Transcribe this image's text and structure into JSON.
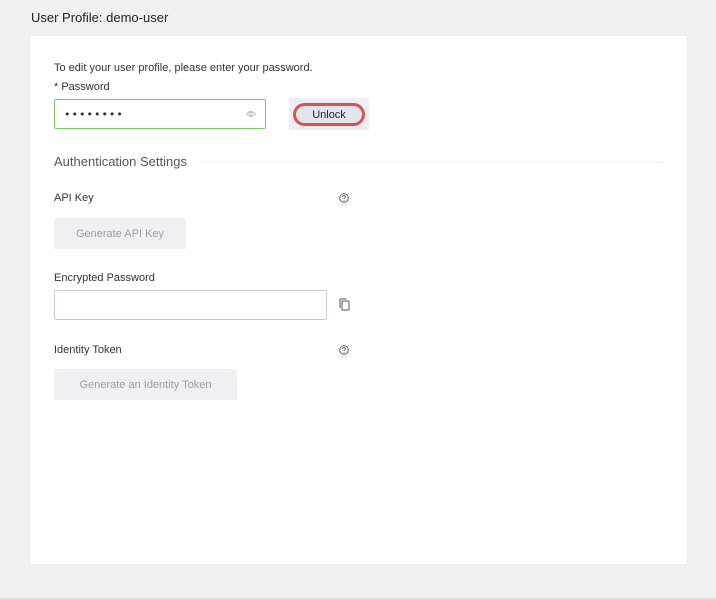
{
  "page": {
    "title": "User Profile: demo-user"
  },
  "unlock_form": {
    "prompt": "To edit your user profile, please enter your password.",
    "password_label": "* Password",
    "password_value": "••••••••",
    "unlock_label": "Unlock"
  },
  "auth_settings": {
    "section_title": "Authentication Settings",
    "api_key": {
      "label": "API Key",
      "button_label": "Generate API Key",
      "help_icon": "question-circle-icon"
    },
    "encrypted_password": {
      "label": "Encrypted Password",
      "value": "",
      "copy_icon": "copy-icon"
    },
    "identity_token": {
      "label": "Identity Token",
      "button_label": "Generate an Identity Token",
      "help_icon": "question-circle-icon"
    }
  },
  "colors": {
    "password_border": "#7cc96a",
    "unlock_highlight": "#d9534f",
    "disabled_button_bg": "#eef0f4",
    "disabled_button_text": "#9aa0a8"
  }
}
